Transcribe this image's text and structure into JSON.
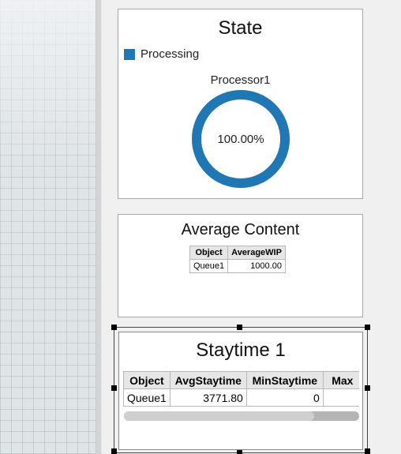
{
  "state_panel": {
    "title": "State",
    "legend": [
      {
        "label": "Processing",
        "color": "#1f77b4"
      }
    ],
    "chart_title": "Processor1",
    "center_label": "100.00%",
    "processing_fraction": 1.0
  },
  "avg_panel": {
    "title": "Average Content",
    "columns": [
      "Object",
      "AverageWIP"
    ],
    "rows": [
      [
        "Queue1",
        "1000.00"
      ]
    ]
  },
  "stay_panel": {
    "title": "Staytime 1",
    "columns": [
      "Object",
      "AvgStaytime",
      "MinStaytime",
      "Max"
    ],
    "rows": [
      [
        "Queue1",
        "3771.80",
        "0",
        ""
      ]
    ],
    "scroll_fraction": 0.81
  },
  "colors": {
    "accent": "#1f77b4"
  }
}
